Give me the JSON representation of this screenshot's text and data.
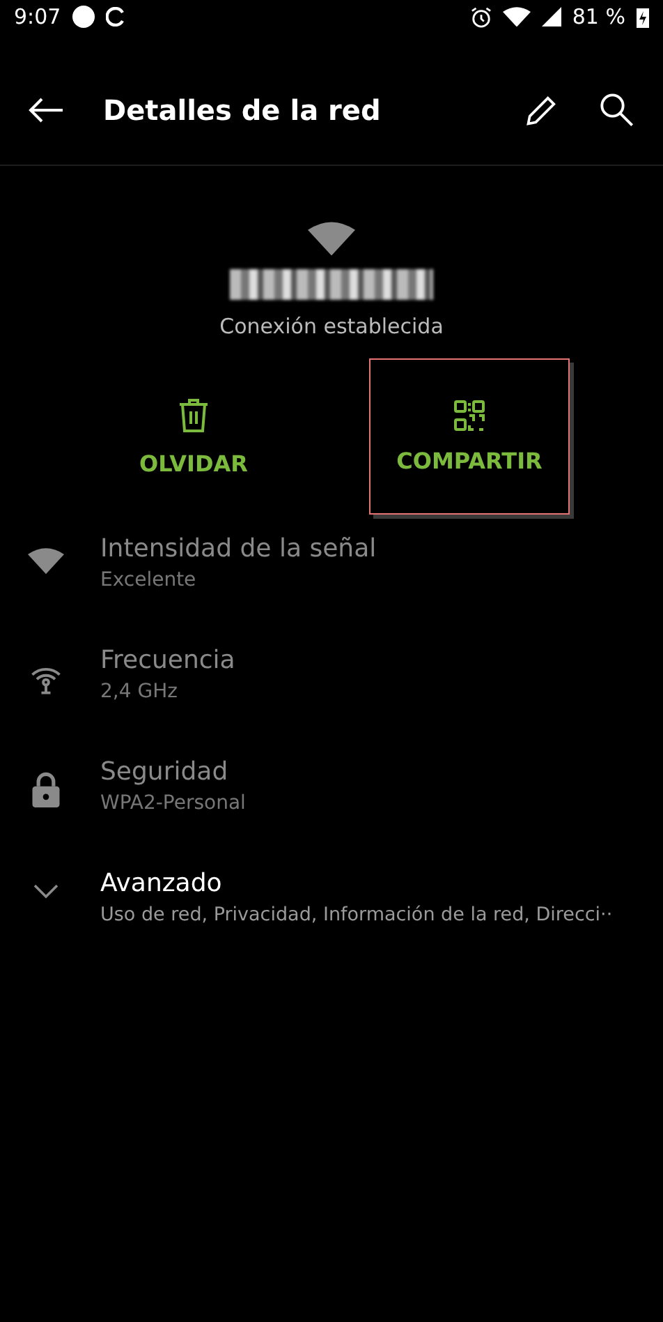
{
  "status_bar": {
    "time": "9:07",
    "battery": "81 %"
  },
  "app_bar": {
    "title": "Detalles de la red"
  },
  "network": {
    "status": "Conexión establecida"
  },
  "actions": [
    {
      "kind": "delete",
      "label": "OLVIDAR",
      "focused": false
    },
    {
      "kind": "share",
      "label": "COMPARTIR",
      "focused": true
    }
  ],
  "details": [
    {
      "kind": "signal",
      "title": "Intensidad de la señal",
      "value": "Excelente",
      "disabled": true
    },
    {
      "kind": "frequency",
      "title": "Frecuencia",
      "value": "2,4 GHz",
      "disabled": true
    },
    {
      "kind": "security",
      "title": "Seguridad",
      "value": "WPA2-Personal",
      "disabled": true
    },
    {
      "kind": "advanced",
      "title": "Avanzado",
      "value": "Uso de red, Privacidad, Información de la red, Direcci··",
      "disabled": false
    }
  ]
}
